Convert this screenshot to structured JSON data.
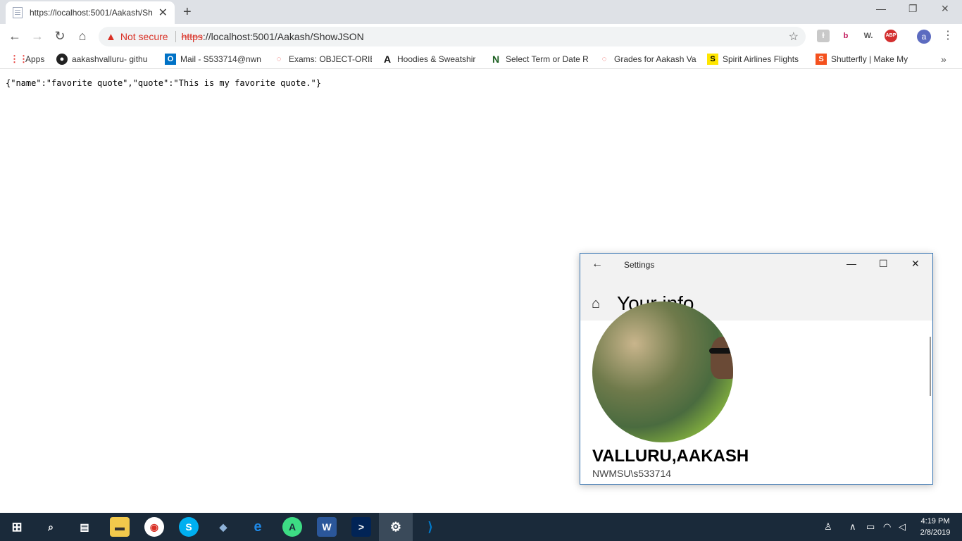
{
  "browser": {
    "tab_title": "https://localhost:5001/Aakash/Sh",
    "tab_close": "✕",
    "new_tab": "+",
    "security_label": "Not secure",
    "url_scheme": "https",
    "url_rest": "://localhost:5001/Aakash/ShowJSON"
  },
  "bookmarks": [
    {
      "label": "Apps",
      "icon": "apps-grid-icon"
    },
    {
      "label": "aakashvalluru- githu",
      "icon": "github-icon"
    },
    {
      "label": "Mail - S533714@nwn",
      "icon": "outlook-icon"
    },
    {
      "label": "Exams: OBJECT-ORIE",
      "icon": "canvas-icon"
    },
    {
      "label": "Hoodies & Sweatshir",
      "icon": "abercrombie-icon"
    },
    {
      "label": "Select Term or Date R",
      "icon": "northwest-icon"
    },
    {
      "label": "Grades for Aakash Va",
      "icon": "canvas-icon"
    },
    {
      "label": "Spirit Airlines Flights",
      "icon": "spirit-icon"
    },
    {
      "label": "Shutterfly | Make My",
      "icon": "shutterfly-icon"
    }
  ],
  "page": {
    "json_text": "{\"name\":\"favorite quote\",\"quote\":\"This is my favorite quote.\"}"
  },
  "settings": {
    "window_title": "Settings",
    "heading": "Your info",
    "full_name": "VALLURU,AAKASH",
    "account": "NWMSU\\s533714"
  },
  "taskbar": {
    "time": "4:19 PM",
    "date": "2/8/2019"
  },
  "colors": {
    "security_warning": "#d93025",
    "taskbar_bg": "#1a2a3a",
    "window_border": "#3c78b4"
  }
}
